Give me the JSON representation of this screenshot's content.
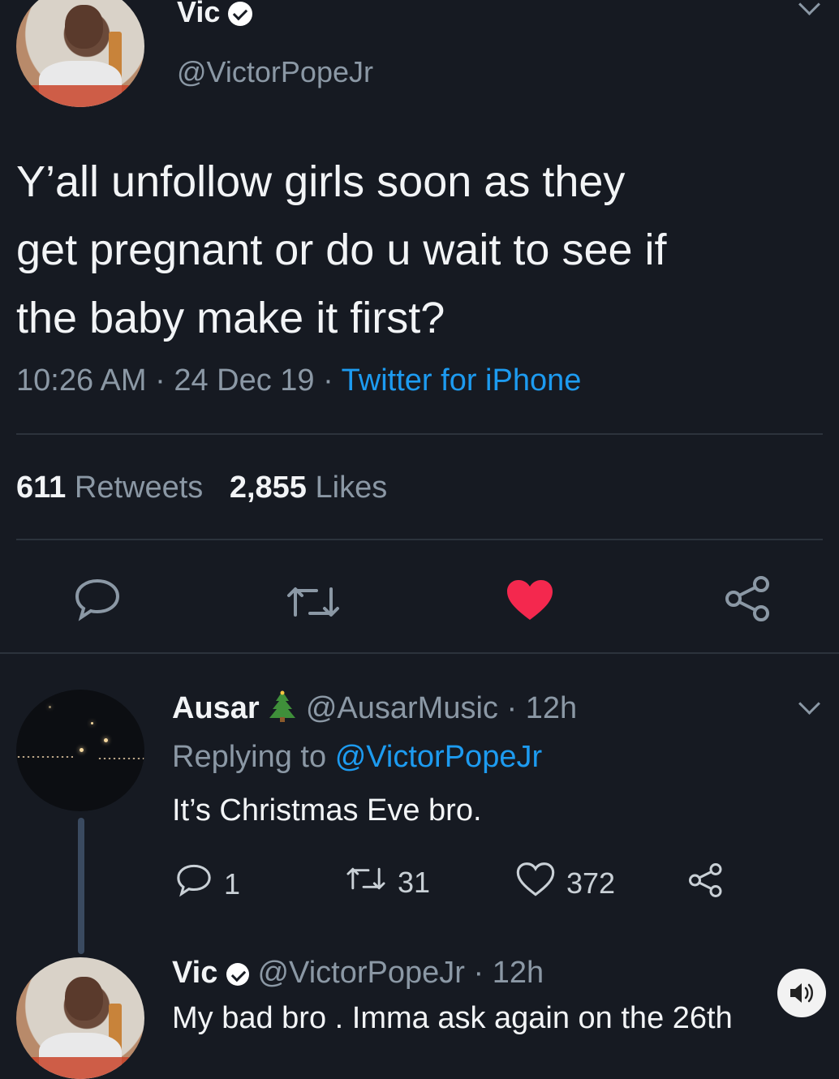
{
  "tweet": {
    "author_name": "Vic",
    "handle": "@VictorPopeJr",
    "text_lines": [
      "Y’all unfollow girls soon as they",
      "get pregnant or do u wait to see if",
      "the baby make it first?"
    ],
    "time": "10:26 AM",
    "date": "24 Dec 19",
    "sep": "·",
    "client": "Twitter for iPhone",
    "retweets_count": "611",
    "retweets_label": "Retweets",
    "likes_count": "2,855",
    "likes_label": "Likes",
    "liked": true,
    "like_color": "#f4284e",
    "icons": [
      "reply-icon",
      "retweet-icon",
      "like-icon",
      "share-icon"
    ]
  },
  "reply1": {
    "author_name": "Ausar",
    "badge": "christmas-tree-icon",
    "handle": "@AusarMusic",
    "time": "· 12h",
    "replying_prefix": "Replying to",
    "replying_to": "@VictorPopeJr",
    "text": "It’s Christmas Eve bro.",
    "reply_count": "1",
    "retweet_count": "31",
    "like_count": "372"
  },
  "reply2": {
    "author_name": "Vic",
    "handle": "@VictorPopeJr",
    "time": "· 12h",
    "text": "My bad bro . Imma ask again on the 26th"
  },
  "accent_color": "#1d9bf0",
  "background_color": "#161a22"
}
